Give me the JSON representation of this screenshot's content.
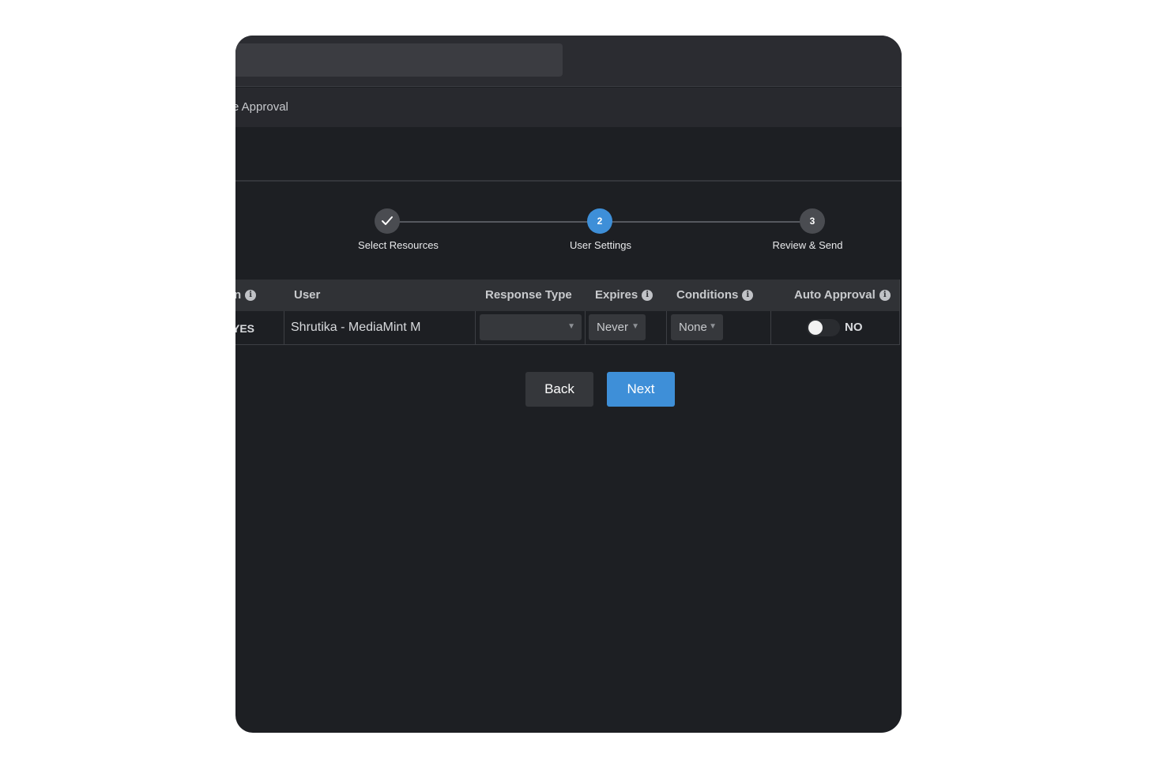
{
  "header": {
    "title_fragment": "e Approval"
  },
  "stepper": {
    "steps": [
      {
        "label": "Select Resources",
        "state": "done"
      },
      {
        "label": "User Settings",
        "number": "2",
        "state": "active"
      },
      {
        "label": "Review & Send",
        "number": "3",
        "state": "pending"
      }
    ]
  },
  "table": {
    "columns": {
      "first_fragment": "n",
      "user": "User",
      "response_type": "Response Type",
      "expires": "Expires",
      "conditions": "Conditions",
      "auto_approval": "Auto Approval"
    },
    "row": {
      "first_fragment": "YES",
      "user": "Shrutika - MediaMint M",
      "response_type": "",
      "expires": "Never",
      "conditions": "None",
      "auto_approval_label": "NO"
    },
    "info_glyph": "i",
    "caret_glyph": "▼"
  },
  "buttons": {
    "back": "Back",
    "next": "Next"
  },
  "colors": {
    "accent": "#3e8fd8",
    "step_done": "#4a4c51",
    "step_pending": "#4a4c51"
  }
}
